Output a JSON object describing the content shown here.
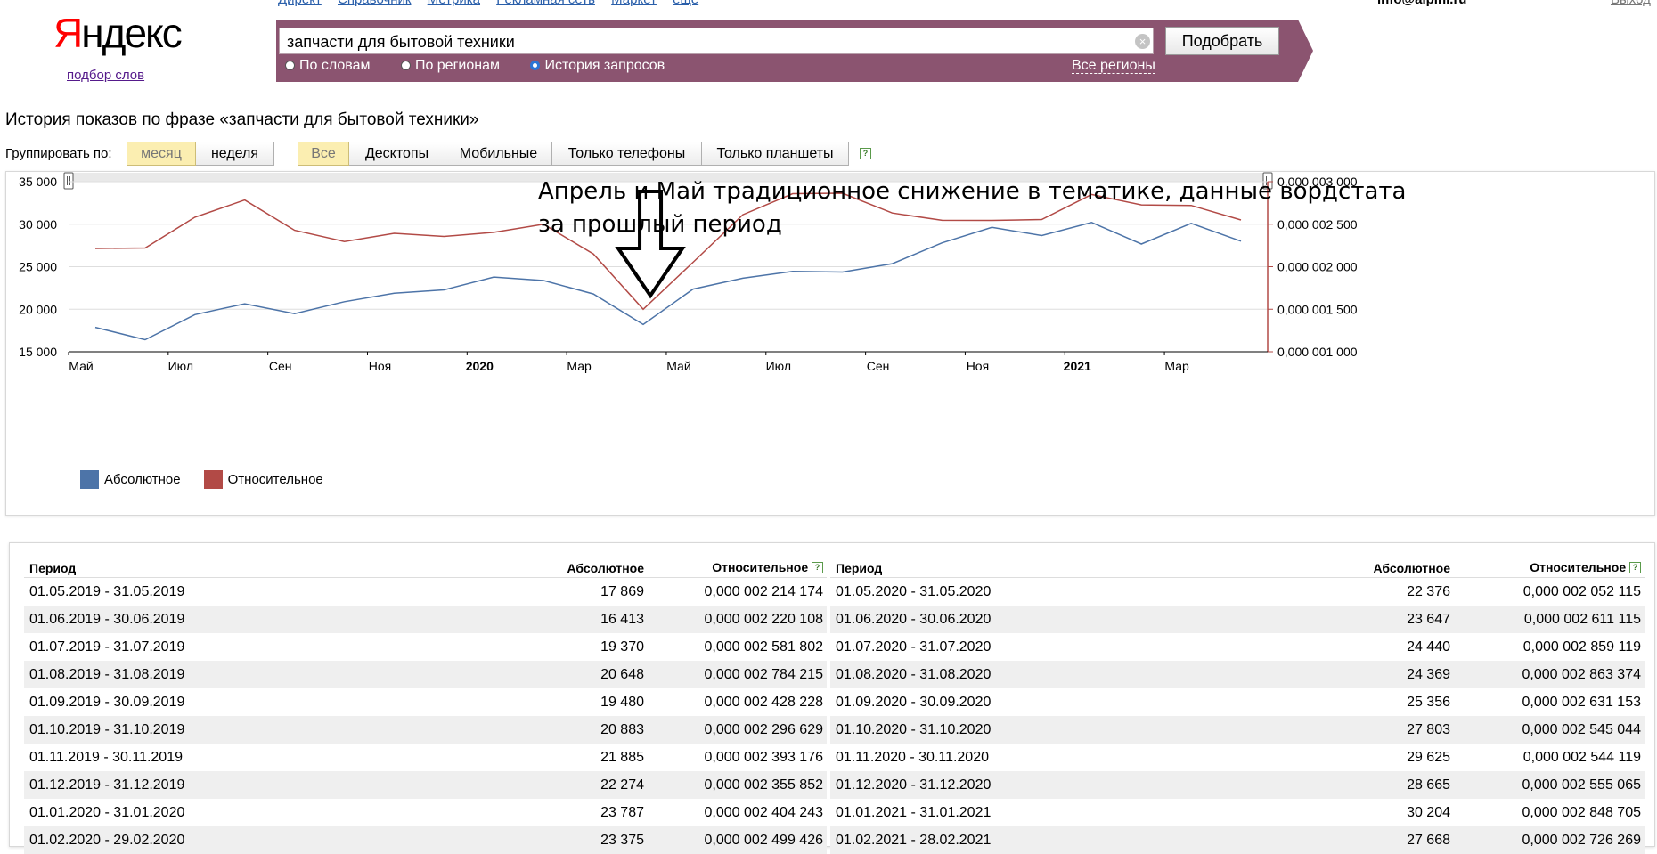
{
  "topnav": [
    "Директ",
    "Справочник",
    "Метрика",
    "Рекламная сеть",
    "Маркет",
    "ещё"
  ],
  "user": "info@alpini.ru",
  "logout": "Выход",
  "logo": {
    "first": "Я",
    "rest": "ндекс",
    "subtitle": "подбор слов"
  },
  "search": {
    "value": "запчасти для бытовой техники",
    "clear_icon": "×",
    "button": "Подобрать",
    "modes": [
      "По словам",
      "По регионам",
      "История запросов"
    ],
    "selected_mode": "История запросов",
    "regions_link": "Все регионы"
  },
  "page_title": "История показов по фразе «запчасти для бытовой техники»",
  "grouping": {
    "label": "Группировать по:",
    "options": [
      "месяц",
      "неделя"
    ],
    "active": "месяц"
  },
  "devices": {
    "options": [
      "Все",
      "Десктопы",
      "Мобильные",
      "Только телефоны",
      "Только планшеты"
    ],
    "active": "Все",
    "help_icon": "?"
  },
  "annotation": "Апрель и Май традиционное снижение в тематике, данные вордстата за прошлый период",
  "chart_data": {
    "type": "line",
    "x": [
      "2019-05",
      "2019-06",
      "2019-07",
      "2019-08",
      "2019-09",
      "2019-10",
      "2019-11",
      "2019-12",
      "2020-01",
      "2020-02",
      "2020-03",
      "2020-04",
      "2020-05",
      "2020-06",
      "2020-07",
      "2020-08",
      "2020-09",
      "2020-10",
      "2020-11",
      "2020-12",
      "2021-01",
      "2021-02",
      "2021-03",
      "2021-04"
    ],
    "x_tick_labels": [
      {
        "at": "2019-05",
        "label": "Май",
        "bold": false
      },
      {
        "at": "2019-07",
        "label": "Июл",
        "bold": false
      },
      {
        "at": "2019-09",
        "label": "Сен",
        "bold": false
      },
      {
        "at": "2019-11",
        "label": "Ноя",
        "bold": false
      },
      {
        "at": "2020-01",
        "label": "2020",
        "bold": true
      },
      {
        "at": "2020-03",
        "label": "Мар",
        "bold": false
      },
      {
        "at": "2020-05",
        "label": "Май",
        "bold": false
      },
      {
        "at": "2020-07",
        "label": "Июл",
        "bold": false
      },
      {
        "at": "2020-09",
        "label": "Сен",
        "bold": false
      },
      {
        "at": "2020-11",
        "label": "Ноя",
        "bold": false
      },
      {
        "at": "2021-01",
        "label": "2021",
        "bold": true
      },
      {
        "at": "2021-03",
        "label": "Мар",
        "bold": false
      }
    ],
    "series": [
      {
        "name": "Абсолютное",
        "color": "#4d74a8",
        "axis": "left",
        "values": [
          17869,
          16413,
          19370,
          20648,
          19480,
          20883,
          21885,
          22274,
          23787,
          23375,
          21800,
          18200,
          22376,
          23647,
          24440,
          24369,
          25356,
          27803,
          29625,
          28665,
          30204,
          27668,
          30100,
          28000
        ]
      },
      {
        "name": "Относительное",
        "color": "#b24a46",
        "axis": "right",
        "values": [
          2.214174e-06,
          2.220108e-06,
          2.581802e-06,
          2.784215e-06,
          2.428228e-06,
          2.296629e-06,
          2.393176e-06,
          2.355852e-06,
          2.404243e-06,
          2.499426e-06,
          2.15e-06,
          1.5e-06,
          2.052115e-06,
          2.611115e-06,
          2.859119e-06,
          2.863374e-06,
          2.631153e-06,
          2.545044e-06,
          2.544119e-06,
          2.555065e-06,
          2.848705e-06,
          2.726269e-06,
          2.72e-06,
          2.55e-06
        ]
      }
    ],
    "y_left": {
      "min": 15000,
      "max": 35000,
      "ticks": [
        15000,
        20000,
        25000,
        30000,
        35000
      ],
      "tick_labels": [
        "15 000",
        "20 000",
        "25 000",
        "30 000",
        "35 000"
      ]
    },
    "y_right": {
      "min": 1e-06,
      "max": 3e-06,
      "ticks": [
        1e-06,
        1.5e-06,
        2e-06,
        2.5e-06,
        3e-06
      ],
      "tick_labels": [
        "0,000 001 000",
        "0,000 001 500",
        "0,000 002 000",
        "0,000 002 500",
        "0,000 003 000"
      ]
    },
    "grid": true,
    "legend": "bottom-left"
  },
  "table": {
    "headers": {
      "period": "Период",
      "abs": "Абсолютное",
      "rel": "Относительное",
      "help": "?"
    },
    "left": [
      [
        "01.05.2019 - 31.05.2019",
        "17 869",
        "0,000 002 214 174"
      ],
      [
        "01.06.2019 - 30.06.2019",
        "16 413",
        "0,000 002 220 108"
      ],
      [
        "01.07.2019 - 31.07.2019",
        "19 370",
        "0,000 002 581 802"
      ],
      [
        "01.08.2019 - 31.08.2019",
        "20 648",
        "0,000 002 784 215"
      ],
      [
        "01.09.2019 - 30.09.2019",
        "19 480",
        "0,000 002 428 228"
      ],
      [
        "01.10.2019 - 31.10.2019",
        "20 883",
        "0,000 002 296 629"
      ],
      [
        "01.11.2019 - 30.11.2019",
        "21 885",
        "0,000 002 393 176"
      ],
      [
        "01.12.2019 - 31.12.2019",
        "22 274",
        "0,000 002 355 852"
      ],
      [
        "01.01.2020 - 31.01.2020",
        "23 787",
        "0,000 002 404 243"
      ],
      [
        "01.02.2020 - 29.02.2020",
        "23 375",
        "0,000 002 499 426"
      ]
    ],
    "right": [
      [
        "01.05.2020 - 31.05.2020",
        "22 376",
        "0,000 002 052 115"
      ],
      [
        "01.06.2020 - 30.06.2020",
        "23 647",
        "0,000 002 611 115"
      ],
      [
        "01.07.2020 - 31.07.2020",
        "24 440",
        "0,000 002 859 119"
      ],
      [
        "01.08.2020 - 31.08.2020",
        "24 369",
        "0,000 002 863 374"
      ],
      [
        "01.09.2020 - 30.09.2020",
        "25 356",
        "0,000 002 631 153"
      ],
      [
        "01.10.2020 - 31.10.2020",
        "27 803",
        "0,000 002 545 044"
      ],
      [
        "01.11.2020 - 30.11.2020",
        "29 625",
        "0,000 002 544 119"
      ],
      [
        "01.12.2020 - 31.12.2020",
        "28 665",
        "0,000 002 555 065"
      ],
      [
        "01.01.2021 - 31.01.2021",
        "30 204",
        "0,000 002 848 705"
      ],
      [
        "01.02.2021 - 28.02.2021",
        "27 668",
        "0,000 002 726 269"
      ]
    ]
  }
}
